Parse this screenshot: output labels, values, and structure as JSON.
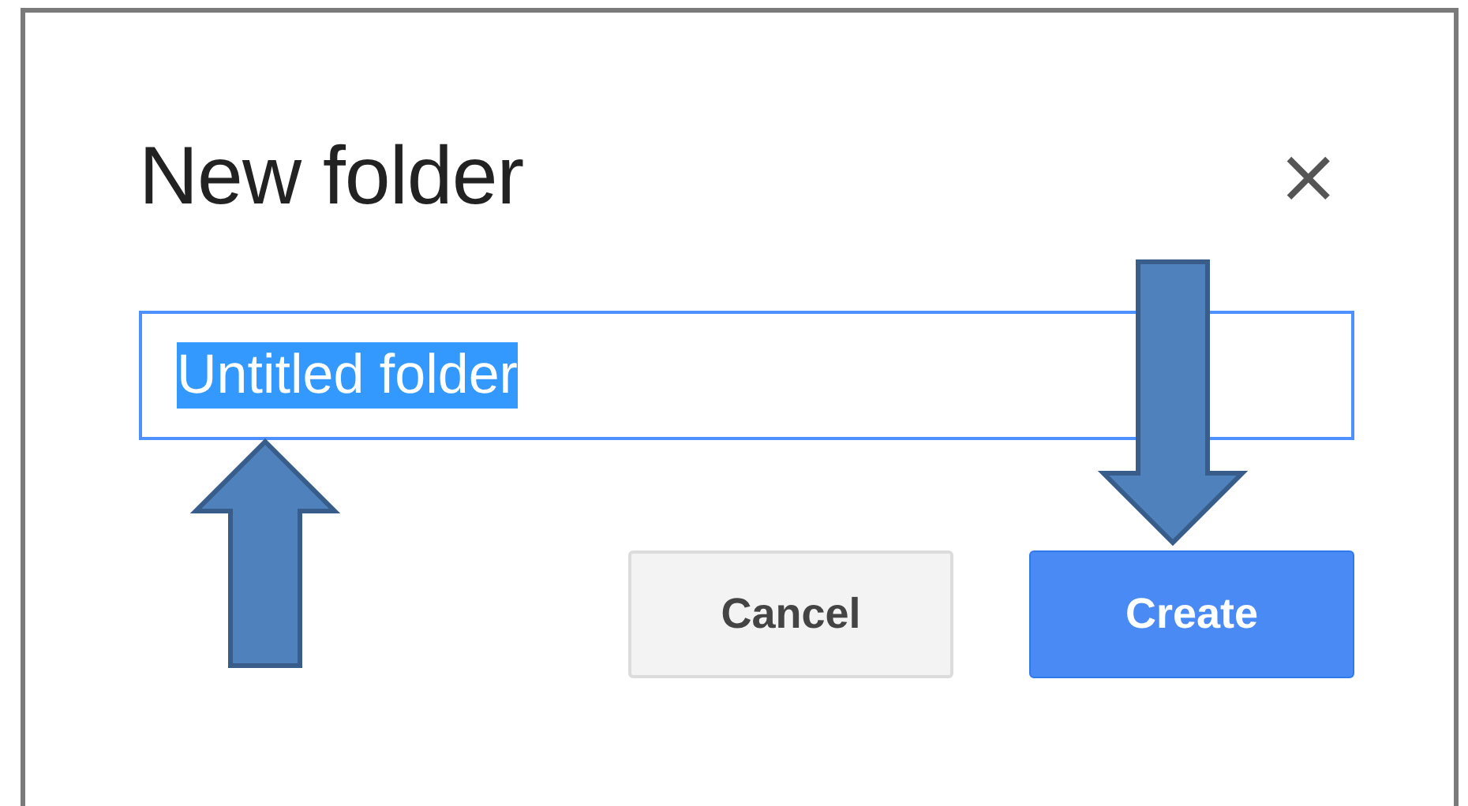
{
  "dialog": {
    "title": "New folder",
    "close": "×"
  },
  "name_field": {
    "value": "Untitled folder",
    "text_selected": true
  },
  "buttons": [
    {
      "label": "Cancel",
      "kind": "secondary"
    },
    {
      "label": "Create",
      "kind": "primary"
    }
  ]
}
